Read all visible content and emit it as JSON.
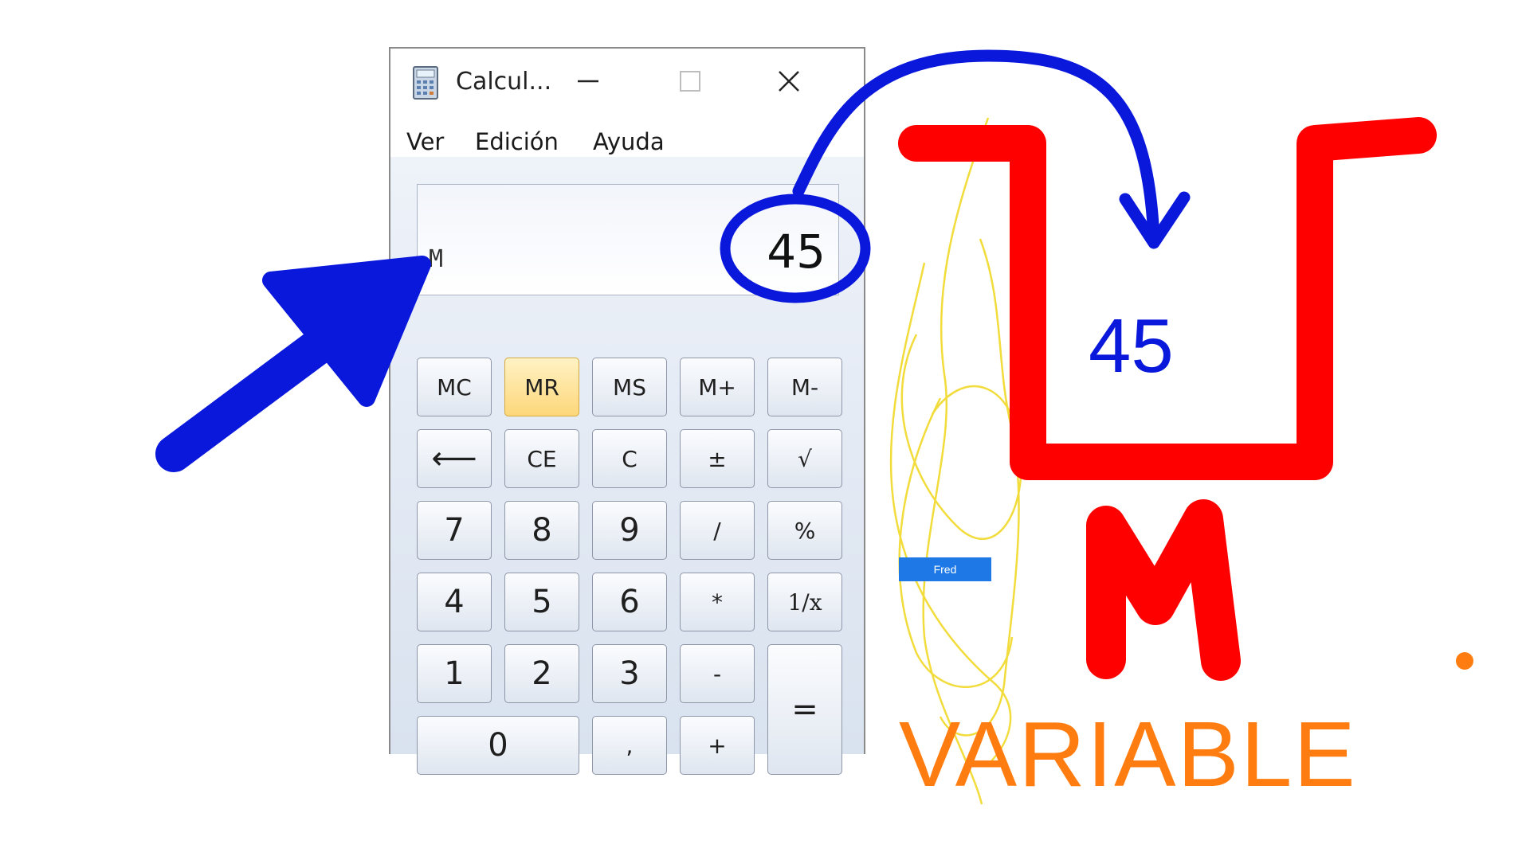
{
  "window": {
    "title": "Calcul...",
    "icon": "calculator-icon",
    "controls": [
      "minimize-icon",
      "maximize-icon",
      "close-icon"
    ]
  },
  "menu": {
    "items": [
      "Ver",
      "Edición",
      "Ayuda"
    ]
  },
  "display": {
    "memory_indicator": "M",
    "value": "45"
  },
  "keys": {
    "mc": "MC",
    "mr": "MR",
    "ms": "MS",
    "mplus": "M+",
    "mminus": "M-",
    "backspace": "⟵",
    "ce": "CE",
    "c": "C",
    "plusminus": "±",
    "sqrt": "√",
    "k7": "7",
    "k8": "8",
    "k9": "9",
    "div": "/",
    "percent": "%",
    "k4": "4",
    "k5": "5",
    "k6": "6",
    "mul": "*",
    "reciprocal": "1/x",
    "k1": "1",
    "k2": "2",
    "k3": "3",
    "minus": "-",
    "equals": "=",
    "k0": "0",
    "decimal": ",",
    "plus": "+"
  },
  "active_key": "MR",
  "annotations": {
    "stored_value": "45",
    "memory_letter": "M",
    "caption": "VARIABLE",
    "button_label": "Fred",
    "colors": {
      "arrow": "#0a18dc",
      "box": "#ff0000",
      "caption": "#ff7d10",
      "scribble": "#f2dc3c",
      "button": "#1e78e6"
    }
  }
}
